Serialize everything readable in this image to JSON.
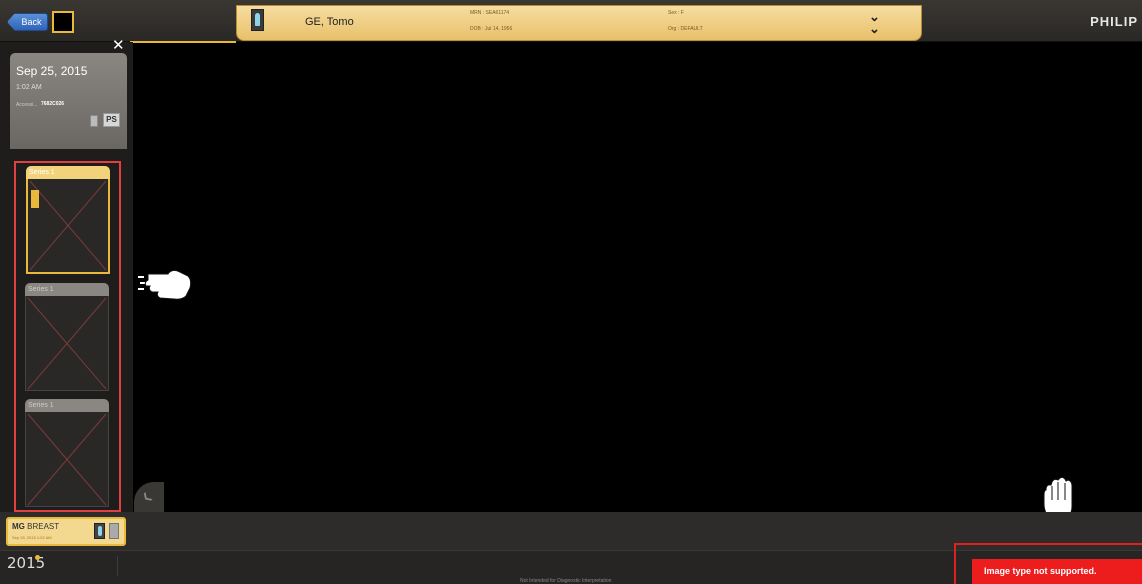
{
  "header": {
    "back_label": "Back",
    "patient_name": "GE, Tomo",
    "mrn": "MRN : SEA61174",
    "dob": "DOB : Jul 14, 1956",
    "sex": "Sex : F",
    "org": "Org : DEFAULT",
    "brand": "PHILIP",
    "expand_icon": "double-chevron-down-icon"
  },
  "sidebar": {
    "close_label": "✕",
    "study": {
      "date": "Sep 25, 2015",
      "time": "1:02 AM",
      "access_label": "Accessi...",
      "access_value": "7682C026",
      "ps_label": "PS",
      "more": "..."
    },
    "series": [
      {
        "label": "Series 1",
        "state": "active"
      },
      {
        "label": "Series 1",
        "state": "inactive"
      },
      {
        "label": "Series 1",
        "state": "inactive"
      }
    ]
  },
  "study_chip": {
    "modality": "MG",
    "body_part": "BREAST",
    "subtitle": "Sep 25, 2015 1:02 AM"
  },
  "footer": {
    "year": "2015",
    "disclaimer": "Not Intended for Diagnostic Interpretation",
    "error_message": "Image type not supported."
  },
  "colors": {
    "accent_gold": "#e8b93a",
    "error_red": "#ee1d1d",
    "highlight_red": "#e04040"
  }
}
